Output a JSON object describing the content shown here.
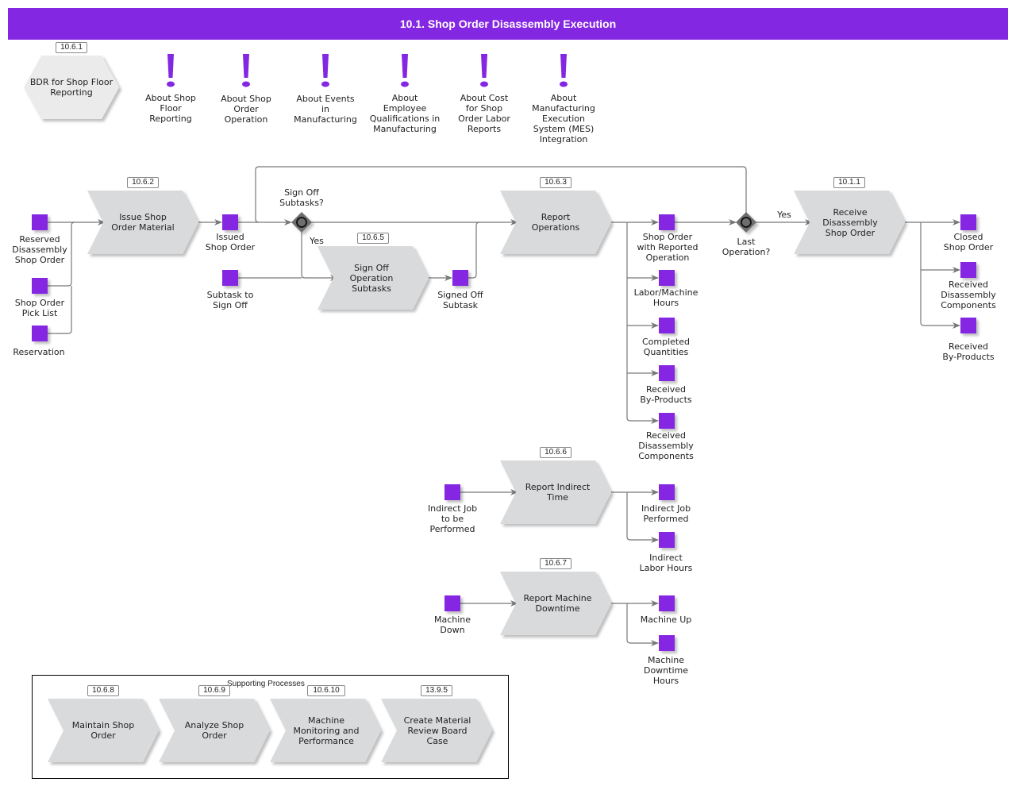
{
  "header": {
    "title": "10.1. Shop Order Disassembly Execution"
  },
  "colors": {
    "accent": "#8427e2",
    "process_fill": "#d9dadc",
    "gateway": "#6e6e6e",
    "line": "#777777"
  },
  "bdr": {
    "ref": "10.6.1",
    "label": "BDR for Shop Floor Reporting"
  },
  "notes": [
    {
      "icon": "exclamation-icon",
      "label": "About Shop\nFloor\nReporting"
    },
    {
      "icon": "exclamation-icon",
      "label": "About Shop\nOrder\nOperation"
    },
    {
      "icon": "exclamation-icon",
      "label": "About Events\nin\nManufacturing"
    },
    {
      "icon": "exclamation-icon",
      "label": "About\nEmployee\nQualifications in\nManufacturing"
    },
    {
      "icon": "exclamation-icon",
      "label": "About Cost\nfor Shop\nOrder Labor\nReports"
    },
    {
      "icon": "exclamation-icon",
      "label": "About\nManufacturing\nExecution\nSystem (MES)\nIntegration"
    }
  ],
  "processes": {
    "issue": {
      "ref": "10.6.2",
      "label": "Issue Shop\nOrder Material"
    },
    "signoff": {
      "ref": "10.6.5",
      "label": "Sign Off\nOperation\nSubtasks"
    },
    "report_ops": {
      "ref": "10.6.3",
      "label": "Report\nOperations"
    },
    "receive": {
      "ref": "10.1.1",
      "label": "Receive\nDisassembly\nShop Order"
    },
    "indirect": {
      "ref": "10.6.6",
      "label": "Report Indirect\nTime"
    },
    "downtime": {
      "ref": "10.6.7",
      "label": "Report Machine\nDowntime"
    }
  },
  "gateways": {
    "signoff_q": {
      "label": "Sign Off\nSubtasks?",
      "yes": "Yes"
    },
    "last_q": {
      "label": "Last\nOperation?",
      "yes": "Yes"
    }
  },
  "objects": {
    "reserved_order": "Reserved\nDisassembly\nShop Order",
    "pick_list": "Shop Order\nPick List",
    "reservation": "Reservation",
    "issued_order": "Issued\nShop Order",
    "subtask_to_sign": "Subtask to\nSign Off",
    "signed_subtask": "Signed Off\nSubtask",
    "order_reported_op": "Shop Order\nwith Reported\nOperation",
    "labor_hours": "Labor/Machine\nHours",
    "completed_qty": "Completed\nQuantities",
    "received_byproducts": "Received\nBy-Products",
    "received_components": "Received\nDisassembly\nComponents",
    "closed_order": "Closed\nShop Order",
    "received_components_2": "Received\nDisassembly\nComponents",
    "received_byproducts_2": "Received\nBy-Products",
    "indirect_job_todo": "Indirect Job\nto be\nPerformed",
    "indirect_job_done": "Indirect Job\nPerformed",
    "indirect_hours": "Indirect\nLabor Hours",
    "machine_down": "Machine\nDown",
    "machine_up": "Machine Up",
    "machine_downtime_hours": "Machine\nDowntime\nHours"
  },
  "supporting": {
    "title": "Supporting Processes",
    "items": [
      {
        "ref": "10.6.8",
        "label": "Maintain Shop\nOrder"
      },
      {
        "ref": "10.6.9",
        "label": "Analyze Shop\nOrder"
      },
      {
        "ref": "10.6.10",
        "label": "Machine\nMonitoring and\nPerformance"
      },
      {
        "ref": "13.9.5",
        "label": "Create Material\nReview Board\nCase"
      }
    ]
  }
}
